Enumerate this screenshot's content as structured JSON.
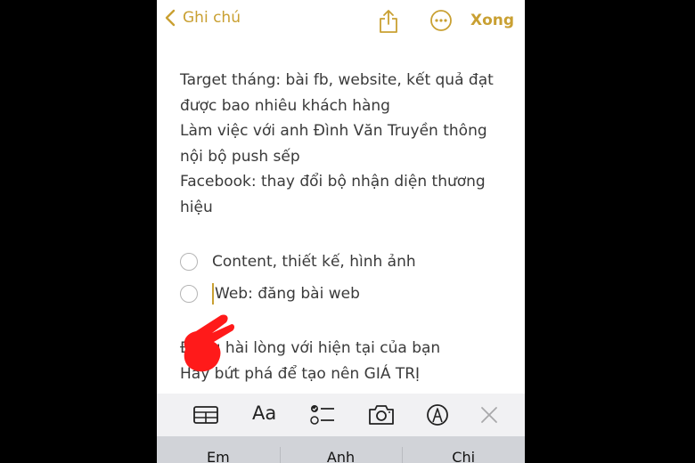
{
  "nav": {
    "back_label": "Ghi chú",
    "share_icon": "share-icon",
    "more_icon": "more-ellipsis-icon",
    "done_label": "Xong"
  },
  "note": {
    "lines": [
      "Target tháng: bài fb, website, kết quả đạt được bao nhiêu khách hàng",
      "Làm việc với anh Đình Văn Truyền thông nội bộ push sếp",
      "Facebook: thay đổi bộ nhận diện thương hiệu"
    ],
    "checklist": [
      {
        "label": "Content, thiết kế, hình ảnh",
        "checked": false
      },
      {
        "label": "Web: đăng bài web",
        "checked": false
      }
    ],
    "after_lines": [
      "Đừng hài lòng với hiện tại của bạn",
      "Hãy bứt phá để tạo nên GIÁ TRỊ"
    ]
  },
  "toolbar": {
    "items": [
      "table-icon",
      "text-format-icon",
      "checklist-icon",
      "camera-icon",
      "markup-pen-icon",
      "close-icon"
    ],
    "format_label": "Aa"
  },
  "suggestions": [
    "Em",
    "Anh",
    "Chi"
  ],
  "colors": {
    "accent": "#c9a032",
    "text": "#3a3a3a",
    "toolbar_bg": "#f1f1f3",
    "keyboard_bg": "#d1d3d8",
    "annotation": "#ff1a1a"
  }
}
